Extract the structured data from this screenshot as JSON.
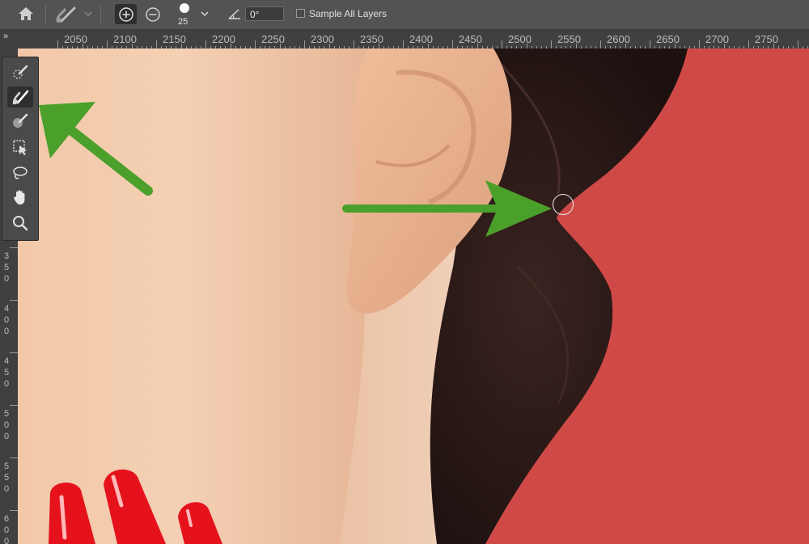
{
  "options_bar": {
    "brush_size": "25",
    "angle_value": "0°",
    "sample_all_layers_label": "Sample All Layers",
    "sample_all_layers_checked": false
  },
  "ruler": {
    "collapse_glyph": "»",
    "top_ticks": [
      "2050",
      "2100",
      "2150",
      "2200",
      "2250",
      "2300",
      "2350",
      "2400",
      "2450",
      "2500",
      "2550",
      "2600",
      "2650",
      "2700",
      "2750"
    ],
    "left_ticks": [
      [
        "3",
        "5",
        "0"
      ],
      [
        "4",
        "0",
        "0"
      ],
      [
        "4",
        "5",
        "0"
      ],
      [
        "5",
        "0",
        "0"
      ],
      [
        "5",
        "5",
        "0"
      ],
      [
        "6",
        "0",
        "0"
      ]
    ]
  },
  "toolbar": {
    "tools": [
      {
        "name": "quick-selection-tool",
        "icon": "quick-selection-icon"
      },
      {
        "name": "refine-edge-brush-tool",
        "icon": "refine-edge-brush-icon",
        "active": true
      },
      {
        "name": "brush-tool",
        "icon": "brush-icon"
      },
      {
        "name": "object-selection-tool",
        "icon": "object-selection-icon"
      },
      {
        "name": "lasso-tool",
        "icon": "lasso-icon"
      },
      {
        "name": "hand-tool",
        "icon": "hand-icon"
      },
      {
        "name": "zoom-tool",
        "icon": "zoom-icon"
      }
    ]
  },
  "colors": {
    "background_red": "#cf4a47",
    "arrow_green": "#4aa02a",
    "skin": "#efc4a3",
    "hair": "#2a1816",
    "nail_red": "#e5121c"
  },
  "annotations": [
    {
      "name": "green-arrow-to-tool",
      "points_to": "refine-edge-brush-tool"
    },
    {
      "name": "green-arrow-to-cursor",
      "points_to": "brush-cursor"
    }
  ]
}
